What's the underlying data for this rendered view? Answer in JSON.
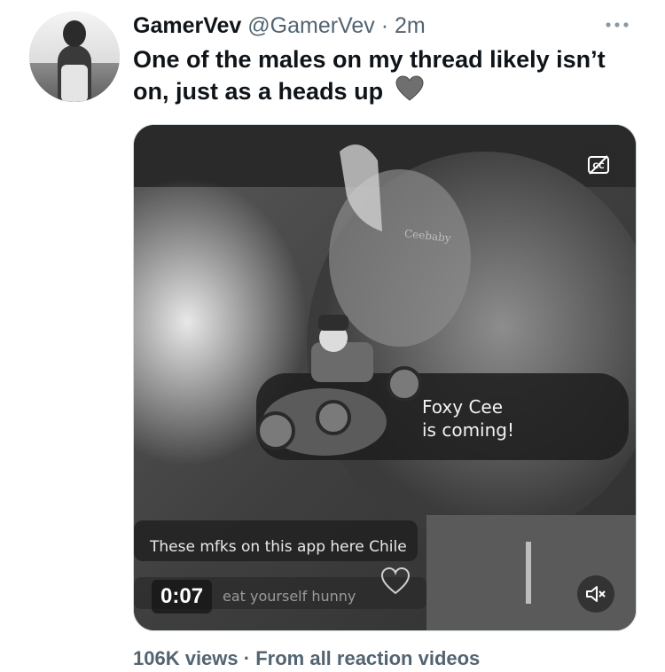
{
  "tweet": {
    "display_name": "GamerVev",
    "handle": "@GamerVev",
    "separator": "·",
    "time": "2m",
    "text": "One of the males on my thread likely isn’t on, just as a heads up",
    "emoji_icon": "grey-heart-icon",
    "more_icon": "more-horizontal-icon"
  },
  "media": {
    "type": "video",
    "duration": "0:07",
    "cc_icon": "closed-captions-off-icon",
    "mute_icon": "volume-muted-icon",
    "overlay_watermark": "Ceebaby",
    "overlay_name_line1": "Foxy Cee",
    "overlay_name_line2": "is coming!",
    "overlay_caption": "These mfks on this app here Chile",
    "overlay_caption2": "eat yourself hunny"
  },
  "footer": {
    "views": "106K views",
    "separator": "·",
    "source": "From all reaction videos"
  }
}
